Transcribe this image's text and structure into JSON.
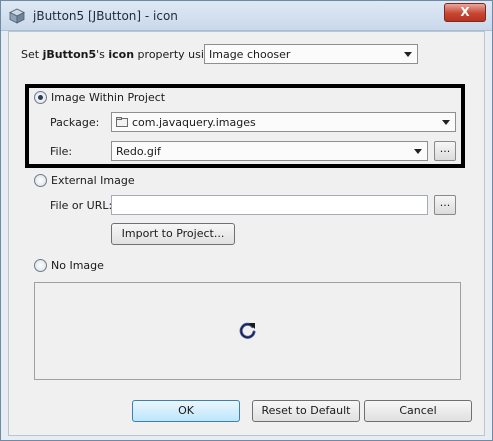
{
  "window": {
    "title": "jButton5 [JButton] - icon",
    "close_label": "X"
  },
  "property": {
    "prefix": "Set ",
    "component": "jButton5",
    "middle": "'s ",
    "property_name": "icon",
    "suffix": " property using:",
    "chooser_value": "Image chooser"
  },
  "image_within_project": {
    "label": "Image Within Project",
    "checked": true,
    "package_label": "Package:",
    "package_value": "com.javaquery.images",
    "file_label": "File:",
    "file_value": "Redo.gif",
    "browse_label": "..."
  },
  "external_image": {
    "label": "External Image",
    "file_url_label": "File or URL:",
    "file_url_value": "",
    "browse_label": "...",
    "import_label": "Import to Project..."
  },
  "no_image": {
    "label": "No Image"
  },
  "buttons": {
    "ok": "OK",
    "reset": "Reset to Default",
    "cancel": "Cancel"
  }
}
